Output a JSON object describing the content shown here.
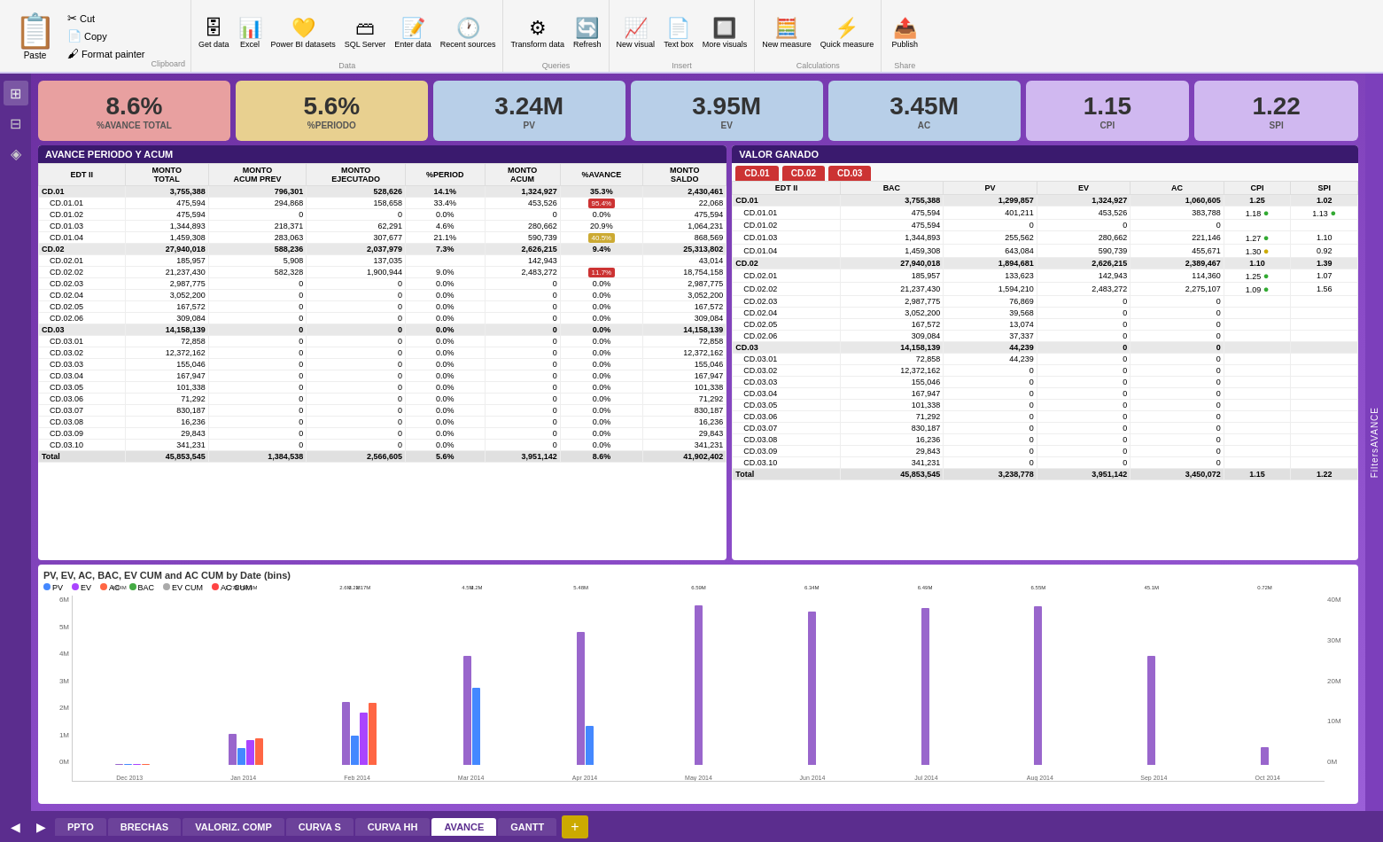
{
  "ribbon": {
    "clipboard": {
      "label": "Clipboard",
      "paste": "Paste",
      "cut": "Cut",
      "copy": "Copy",
      "format_painter": "Format painter"
    },
    "data": {
      "label": "Data",
      "get_data": "Get data",
      "excel": "Excel",
      "power_bi": "Power BI datasets",
      "sql_server": "SQL Server",
      "enter_data": "Enter data",
      "recent_sources": "Recent sources"
    },
    "queries": {
      "label": "Queries",
      "transform": "Transform data",
      "refresh": "Refresh"
    },
    "insert": {
      "label": "Insert",
      "new_visual": "New visual",
      "text_box": "Text box",
      "more_visuals": "More visuals"
    },
    "calculations": {
      "label": "Calculations",
      "new_measure": "New measure",
      "quick_measure": "Quick measure"
    },
    "share": {
      "label": "Share",
      "publish": "Publish"
    }
  },
  "kpis": [
    {
      "value": "8.6%",
      "label": "%AVANCE TOTAL",
      "class": "avance"
    },
    {
      "value": "5.6%",
      "label": "%PERIODO",
      "class": "periodo"
    },
    {
      "value": "3.24M",
      "label": "PV",
      "class": "pv"
    },
    {
      "value": "3.95M",
      "label": "EV",
      "class": "ev"
    },
    {
      "value": "3.45M",
      "label": "AC",
      "class": "ac"
    },
    {
      "value": "1.15",
      "label": "CPI",
      "class": "cpi"
    },
    {
      "value": "1.22",
      "label": "SPI",
      "class": "spi"
    }
  ],
  "left_table": {
    "title": "AVANCE PERIODO Y ACUM",
    "headers": [
      "EDT II",
      "MONTO TOTAL",
      "MONTO ACUM PREV",
      "MONTO EJECUTADO",
      "%PERIOD",
      "MONTO ACUM",
      "%AVANCE",
      "MONTO SALDO"
    ],
    "rows": [
      {
        "edt": "CD.01",
        "total": "3,755,388",
        "acum_prev": "796,301",
        "ejecutado": "528,626",
        "period": "14.1%",
        "acum": "1,324,927",
        "avance": "35.3%",
        "saldo": "2,430,461",
        "group": true
      },
      {
        "edt": "CD.01.01",
        "total": "475,594",
        "acum_prev": "294,868",
        "ejecutado": "158,658",
        "period": "33.4%",
        "acum": "453,526",
        "avance": "95.4%",
        "saldo": "22,068",
        "badge": "red",
        "indent": true
      },
      {
        "edt": "CD.01.02",
        "total": "475,594",
        "acum_prev": "0",
        "ejecutado": "0",
        "period": "0.0%",
        "acum": "0",
        "avance": "0.0%",
        "saldo": "475,594",
        "indent": true
      },
      {
        "edt": "CD.01.03",
        "total": "1,344,893",
        "acum_prev": "218,371",
        "ejecutado": "62,291",
        "period": "4.6%",
        "acum": "280,662",
        "avance": "20.9%",
        "saldo": "1,064,231",
        "indent": true
      },
      {
        "edt": "CD.01.04",
        "total": "1,459,308",
        "acum_prev": "283,063",
        "ejecutado": "307,677",
        "period": "21.1%",
        "acum": "590,739",
        "avance": "40.5%",
        "saldo": "868,569",
        "badge": "yellow",
        "indent": true
      },
      {
        "edt": "CD.02",
        "total": "27,940,018",
        "acum_prev": "588,236",
        "ejecutado": "2,037,979",
        "period": "7.3%",
        "acum": "2,626,215",
        "avance": "9.4%",
        "saldo": "25,313,802",
        "group": true
      },
      {
        "edt": "CD.02.01",
        "total": "185,957",
        "acum_prev": "5,908",
        "ejecutado": "137,035",
        "period": "",
        "acum": "142,943",
        "avance": "",
        "saldo": "43,014",
        "indent": true
      },
      {
        "edt": "CD.02.02",
        "total": "21,237,430",
        "acum_prev": "582,328",
        "ejecutado": "1,900,944",
        "period": "9.0%",
        "acum": "2,483,272",
        "avance": "11.7%",
        "saldo": "18,754,158",
        "badge": "red",
        "indent": true
      },
      {
        "edt": "CD.02.03",
        "total": "2,987,775",
        "acum_prev": "0",
        "ejecutado": "0",
        "period": "0.0%",
        "acum": "0",
        "avance": "0.0%",
        "saldo": "2,987,775",
        "indent": true
      },
      {
        "edt": "CD.02.04",
        "total": "3,052,200",
        "acum_prev": "0",
        "ejecutado": "0",
        "period": "0.0%",
        "acum": "0",
        "avance": "0.0%",
        "saldo": "3,052,200",
        "indent": true
      },
      {
        "edt": "CD.02.05",
        "total": "167,572",
        "acum_prev": "0",
        "ejecutado": "0",
        "period": "0.0%",
        "acum": "0",
        "avance": "0.0%",
        "saldo": "167,572",
        "indent": true
      },
      {
        "edt": "CD.02.06",
        "total": "309,084",
        "acum_prev": "0",
        "ejecutado": "0",
        "period": "0.0%",
        "acum": "0",
        "avance": "0.0%",
        "saldo": "309,084",
        "indent": true
      },
      {
        "edt": "CD.03",
        "total": "14,158,139",
        "acum_prev": "0",
        "ejecutado": "0",
        "period": "0.0%",
        "acum": "0",
        "avance": "0.0%",
        "saldo": "14,158,139",
        "group": true
      },
      {
        "edt": "CD.03.01",
        "total": "72,858",
        "acum_prev": "0",
        "ejecutado": "0",
        "period": "0.0%",
        "acum": "0",
        "avance": "0.0%",
        "saldo": "72,858",
        "indent": true
      },
      {
        "edt": "CD.03.02",
        "total": "12,372,162",
        "acum_prev": "0",
        "ejecutado": "0",
        "period": "0.0%",
        "acum": "0",
        "avance": "0.0%",
        "saldo": "12,372,162",
        "indent": true
      },
      {
        "edt": "CD.03.03",
        "total": "155,046",
        "acum_prev": "0",
        "ejecutado": "0",
        "period": "0.0%",
        "acum": "0",
        "avance": "0.0%",
        "saldo": "155,046",
        "indent": true
      },
      {
        "edt": "CD.03.04",
        "total": "167,947",
        "acum_prev": "0",
        "ejecutado": "0",
        "period": "0.0%",
        "acum": "0",
        "avance": "0.0%",
        "saldo": "167,947",
        "indent": true
      },
      {
        "edt": "CD.03.05",
        "total": "101,338",
        "acum_prev": "0",
        "ejecutado": "0",
        "period": "0.0%",
        "acum": "0",
        "avance": "0.0%",
        "saldo": "101,338",
        "indent": true
      },
      {
        "edt": "CD.03.06",
        "total": "71,292",
        "acum_prev": "0",
        "ejecutado": "0",
        "period": "0.0%",
        "acum": "0",
        "avance": "0.0%",
        "saldo": "71,292",
        "indent": true
      },
      {
        "edt": "CD.03.07",
        "total": "830,187",
        "acum_prev": "0",
        "ejecutado": "0",
        "period": "0.0%",
        "acum": "0",
        "avance": "0.0%",
        "saldo": "830,187",
        "indent": true
      },
      {
        "edt": "CD.03.08",
        "total": "16,236",
        "acum_prev": "0",
        "ejecutado": "0",
        "period": "0.0%",
        "acum": "0",
        "avance": "0.0%",
        "saldo": "16,236",
        "indent": true
      },
      {
        "edt": "CD.03.09",
        "total": "29,843",
        "acum_prev": "0",
        "ejecutado": "0",
        "period": "0.0%",
        "acum": "0",
        "avance": "0.0%",
        "saldo": "29,843",
        "indent": true
      },
      {
        "edt": "CD.03.10",
        "total": "341,231",
        "acum_prev": "0",
        "ejecutado": "0",
        "period": "0.0%",
        "acum": "0",
        "avance": "0.0%",
        "saldo": "341,231",
        "indent": true
      },
      {
        "edt": "Total",
        "total": "45,853,545",
        "acum_prev": "1,384,538",
        "ejecutado": "2,566,605",
        "period": "5.6%",
        "acum": "3,951,142",
        "avance": "8.6%",
        "saldo": "41,902,402",
        "total_row": true
      }
    ]
  },
  "right_table": {
    "title": "VALOR GANADO",
    "headers": [
      "EDT II",
      "BAC",
      "PV",
      "EV",
      "AC",
      "CPI",
      "SPI"
    ],
    "cd_tabs": [
      "CD.01",
      "CD.02",
      "CD.03"
    ],
    "rows": [
      {
        "edt": "CD.01",
        "bac": "3,755,388",
        "pv": "1,299,857",
        "ev": "1,324,927",
        "ac": "1,060,605",
        "cpi": "1.25",
        "spi": "1.02",
        "group": true
      },
      {
        "edt": "CD.01.01",
        "bac": "475,594",
        "pv": "401,211",
        "ev": "453,526",
        "ac": "383,788",
        "cpi": "1.18",
        "spi": "1.13",
        "dot_cpi": "green",
        "dot_spi": "green",
        "indent": true
      },
      {
        "edt": "CD.01.02",
        "bac": "475,594",
        "pv": "0",
        "ev": "0",
        "ac": "0",
        "cpi": "",
        "spi": "",
        "indent": true
      },
      {
        "edt": "CD.01.03",
        "bac": "1,344,893",
        "pv": "255,562",
        "ev": "280,662",
        "ac": "221,146",
        "cpi": "1.27",
        "spi": "1.10",
        "dot_cpi": "green",
        "indent": true
      },
      {
        "edt": "CD.01.04",
        "bac": "1,459,308",
        "pv": "643,084",
        "ev": "590,739",
        "ac": "455,671",
        "cpi": "1.30",
        "spi": "0.92",
        "dot_cpi": "yellow",
        "indent": true
      },
      {
        "edt": "CD.02",
        "bac": "27,940,018",
        "pv": "1,894,681",
        "ev": "2,626,215",
        "ac": "2,389,467",
        "cpi": "1.10",
        "spi": "1.39",
        "group": true
      },
      {
        "edt": "CD.02.01",
        "bac": "185,957",
        "pv": "133,623",
        "ev": "142,943",
        "ac": "114,360",
        "cpi": "1.25",
        "spi": "1.07",
        "dot_cpi": "green",
        "indent": true
      },
      {
        "edt": "CD.02.02",
        "bac": "21,237,430",
        "pv": "1,594,210",
        "ev": "2,483,272",
        "ac": "2,275,107",
        "cpi": "1.09",
        "spi": "1.56",
        "dot_cpi": "green",
        "indent": true
      },
      {
        "edt": "CD.02.03",
        "bac": "2,987,775",
        "pv": "76,869",
        "ev": "0",
        "ac": "0",
        "cpi": "",
        "spi": "",
        "indent": true
      },
      {
        "edt": "CD.02.04",
        "bac": "3,052,200",
        "pv": "39,568",
        "ev": "0",
        "ac": "0",
        "cpi": "",
        "spi": "",
        "indent": true
      },
      {
        "edt": "CD.02.05",
        "bac": "167,572",
        "pv": "13,074",
        "ev": "0",
        "ac": "0",
        "cpi": "",
        "spi": "",
        "indent": true
      },
      {
        "edt": "CD.02.06",
        "bac": "309,084",
        "pv": "37,337",
        "ev": "0",
        "ac": "0",
        "cpi": "",
        "spi": "",
        "indent": true
      },
      {
        "edt": "CD.03",
        "bac": "14,158,139",
        "pv": "44,239",
        "ev": "0",
        "ac": "0",
        "cpi": "",
        "spi": "",
        "group": true
      },
      {
        "edt": "CD.03.01",
        "bac": "72,858",
        "pv": "44,239",
        "ev": "0",
        "ac": "0",
        "cpi": "",
        "spi": "",
        "indent": true
      },
      {
        "edt": "CD.03.02",
        "bac": "12,372,162",
        "pv": "0",
        "ev": "0",
        "ac": "0",
        "cpi": "",
        "spi": "",
        "indent": true
      },
      {
        "edt": "CD.03.03",
        "bac": "155,046",
        "pv": "0",
        "ev": "0",
        "ac": "0",
        "cpi": "",
        "spi": "",
        "indent": true
      },
      {
        "edt": "CD.03.04",
        "bac": "167,947",
        "pv": "0",
        "ev": "0",
        "ac": "0",
        "cpi": "",
        "spi": "",
        "indent": true
      },
      {
        "edt": "CD.03.05",
        "bac": "101,338",
        "pv": "0",
        "ev": "0",
        "ac": "0",
        "cpi": "",
        "spi": "",
        "indent": true
      },
      {
        "edt": "CD.03.06",
        "bac": "71,292",
        "pv": "0",
        "ev": "0",
        "ac": "0",
        "cpi": "",
        "spi": "",
        "indent": true
      },
      {
        "edt": "CD.03.07",
        "bac": "830,187",
        "pv": "0",
        "ev": "0",
        "ac": "0",
        "cpi": "",
        "spi": "",
        "indent": true
      },
      {
        "edt": "CD.03.08",
        "bac": "16,236",
        "pv": "0",
        "ev": "0",
        "ac": "0",
        "cpi": "",
        "spi": "",
        "indent": true
      },
      {
        "edt": "CD.03.09",
        "bac": "29,843",
        "pv": "0",
        "ev": "0",
        "ac": "0",
        "cpi": "",
        "spi": "",
        "indent": true
      },
      {
        "edt": "CD.03.10",
        "bac": "341,231",
        "pv": "0",
        "ev": "0",
        "ac": "0",
        "cpi": "",
        "spi": "",
        "indent": true
      },
      {
        "edt": "Total",
        "bac": "45,853,545",
        "pv": "3,238,778",
        "ev": "3,951,142",
        "ac": "3,450,072",
        "cpi": "1.15",
        "spi": "1.22",
        "total_row": true
      }
    ]
  },
  "chart": {
    "title": "PV, EV, AC, BAC, EV CUM and AC CUM by Date (bins)",
    "legend": [
      {
        "label": "PV",
        "color": "#4488ff"
      },
      {
        "label": "EV",
        "color": "#aa44ff"
      },
      {
        "label": "AC",
        "color": "#ff6644"
      },
      {
        "label": "BAC",
        "color": "#44aa44"
      },
      {
        "label": "EV CUM",
        "color": "#aaaaaa"
      },
      {
        "label": "AC CUM",
        "color": "#ff4444"
      }
    ],
    "months": [
      "December 2013",
      "January 2014",
      "February 2014",
      "March 2014",
      "April 2014",
      "May 2014",
      "June 2014",
      "July 2014",
      "August 2014",
      "September 2014",
      "October 2014"
    ],
    "bars": [
      {
        "month": "Dec 2013",
        "pv": 0.04,
        "ev": 0.04,
        "ac": 0.04,
        "bac": 0.04,
        "ev_cum": 0.04,
        "ac_cum": 0.04,
        "label_pv": "0.04M"
      },
      {
        "month": "Jan 2014",
        "pv": 0.7,
        "ev": 1.03,
        "ac": 1.1,
        "bac": 1.27,
        "label_pv": "0.7M",
        "label_ev": "1.03M",
        "label_ac": "1.1M"
      },
      {
        "month": "Feb 2014",
        "pv": 1.2,
        "ev": 2.17,
        "ac": 2.57,
        "bac": 2.6,
        "label_pv": "1.2M",
        "label_ev": "2.17M"
      },
      {
        "month": "Mar 2014",
        "pv": 3.2,
        "ev": 0,
        "ac": 0,
        "bac": 4.5,
        "label_pv": "3.2M",
        "label_bac": "4.5M"
      },
      {
        "month": "Apr 2014",
        "pv": 1.6,
        "ev": 0,
        "ac": 0,
        "bac": 5.48,
        "label_bac": "5.48M"
      },
      {
        "month": "May 2014",
        "pv": 0,
        "ev": 0,
        "ac": 0,
        "bac": 6.59,
        "label_bac": "6.59M"
      },
      {
        "month": "Jun 2014",
        "pv": 0,
        "ev": 0,
        "ac": 0,
        "bac": 6.34,
        "label_bac": "6.34M"
      },
      {
        "month": "Jul 2014",
        "pv": 0,
        "ev": 0,
        "ac": 0,
        "bac": 6.49,
        "label_bac": "6.49M"
      },
      {
        "month": "Aug 2014",
        "pv": 0,
        "ev": 0,
        "ac": 0,
        "bac": 6.55,
        "label_bac": "6.55M"
      },
      {
        "month": "Sep 2014",
        "pv": 0,
        "ev": 0,
        "ac": 0,
        "bac": 4.51,
        "label_bac": "45.1M"
      },
      {
        "month": "Oct 2014",
        "pv": 0,
        "ev": 0,
        "ac": 0,
        "bac": 0.72,
        "label_bac": "0.72M"
      }
    ],
    "y_left": [
      "6M",
      "5M",
      "4M",
      "3M",
      "2M",
      "1M",
      "0M"
    ],
    "y_right": [
      "40M",
      "30M",
      "20M",
      "10M",
      "0M"
    ]
  },
  "tabs": {
    "items": [
      "PPTO",
      "BRECHAS",
      "VALORIZ. COMP",
      "CURVA S",
      "CURVA HH",
      "AVANCE",
      "GANTT"
    ],
    "active": "AVANCE"
  },
  "colors": {
    "purple_dark": "#5b2d8e",
    "purple_mid": "#7c3fbb",
    "accent_red": "#cc3333",
    "accent_yellow": "#ccaa00"
  }
}
